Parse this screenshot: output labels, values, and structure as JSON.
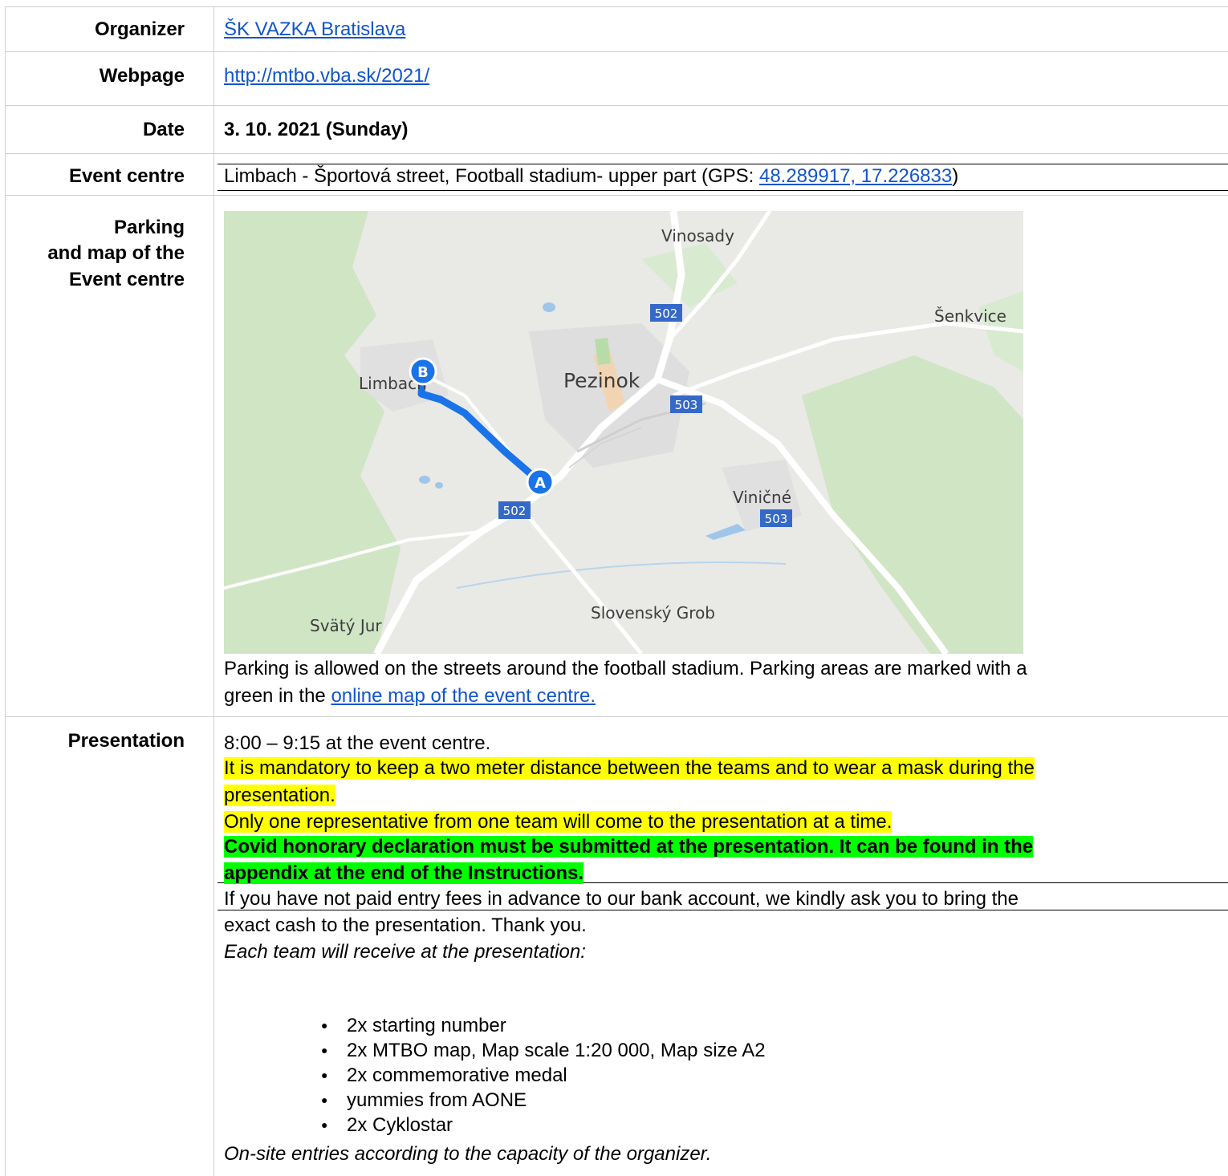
{
  "rows": {
    "organizer": {
      "label": "Organizer",
      "value": "ŠK VAZKA Bratislava"
    },
    "webpage": {
      "label": "Webpage",
      "value": "http://mtbo.vba.sk/2021/"
    },
    "date": {
      "label": "Date",
      "value": "3. 10. 2021 (Sunday)"
    },
    "event_centre": {
      "label": "Event centre",
      "text_before": "Limbach - Športová street, Football stadium- upper part (GPS: ",
      "gps_link": "48.289917, 17.226833",
      "text_after": ")"
    },
    "parking": {
      "label_line1": "Parking",
      "label_line2": "and map of the",
      "label_line3": "Event centre",
      "text_line1": "Parking is allowed on the streets around the football stadium. Parking areas are marked with a",
      "text_line2_before": "green in the ",
      "text_line2_link": "online map of the event centre."
    },
    "presentation": {
      "label": "Presentation",
      "time": "8:00 – 9:15 at the event centre.",
      "mask_line1": "It is mandatory to keep a two meter distance between the teams and to wear a mask during the",
      "mask_line2": "presentation.",
      "one_rep": "Only one representative from one team will come to the presentation at a time.",
      "covid_line1": "Covid honorary declaration must be submitted at the presentation. It can be found in the",
      "covid_line2": "appendix at the end of the Instructions.",
      "fees_line1": "If you have not paid entry fees in advance to our bank account, we kindly ask you to bring the",
      "fees_line2": "exact cash to the presentation. Thank you.",
      "receive": "Each team will receive at the presentation:",
      "items": [
        "2x starting number",
        "2x MTBO map, Map scale 1:20 000, Map size A2",
        "2x commemorative medal",
        "yummies from AONE",
        "2x Cyklostar"
      ],
      "onsite": "On-site entries according to the capacity of the organizer."
    }
  },
  "map": {
    "places": {
      "vinosady": "Vinosady",
      "senkvice": "Šenkvice",
      "limbach": "Limbach",
      "pezinok": "Pezinok",
      "vinicne": "Viničné",
      "slovensky_grob": "Slovenský Grob",
      "svaty_jur": "Svätý Jur"
    },
    "roads": {
      "r502a": "502",
      "r503a": "503",
      "r502b": "502",
      "r503b": "503"
    },
    "markers": {
      "start": "A",
      "end": "B"
    },
    "colors": {
      "land": "#e8e8e8",
      "forest": "#cfe6c7",
      "road": "#ffffff",
      "route": "#1a73e8",
      "water": "#9fc6e8",
      "shield": "#3569c8"
    }
  }
}
